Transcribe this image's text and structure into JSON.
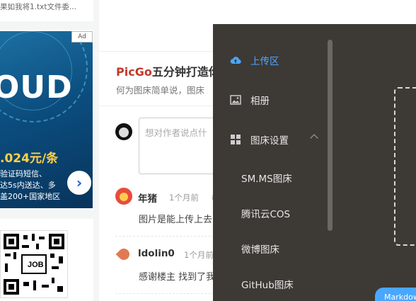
{
  "sidebar": {
    "top_snippet": "果如我将1.txt文件委...",
    "ad": {
      "tag": "Ad",
      "headline": "OUD",
      "price": ".024元/条",
      "lines": [
        "验证码短信、",
        "达5s内送达、多",
        "盖200+国家地区"
      ],
      "arrow": "›"
    },
    "qr_label": "JOB"
  },
  "article": {
    "title_brand": "PicGo",
    "title_rest": "五分钟打造你",
    "summary": "何为图床简单说，图床"
  },
  "comment_input": {
    "placeholder": "想对作者说点什"
  },
  "comments": [
    {
      "author": "年猪",
      "time": "1个月前",
      "extra": "#",
      "text": "图片是能上传上去"
    },
    {
      "author": "ldolin0",
      "time": "1个月前",
      "extra": "",
      "text": "感谢楼主 找到了我"
    }
  ],
  "drawer": {
    "menu": [
      {
        "label": "上传区",
        "icon": "cloud-upload-icon",
        "active": true
      },
      {
        "label": "相册",
        "icon": "image-icon",
        "active": false
      },
      {
        "label": "图床设置",
        "icon": "grid-icon",
        "active": false
      }
    ],
    "sub_items": [
      "SM.MS图床",
      "腾讯云COS",
      "微博图床",
      "GitHub图床"
    ],
    "badge": "Markdown"
  },
  "colors": {
    "drawer_bg": "#3d3935",
    "accent": "#4aa7ff",
    "brand_red": "#c0392b"
  }
}
